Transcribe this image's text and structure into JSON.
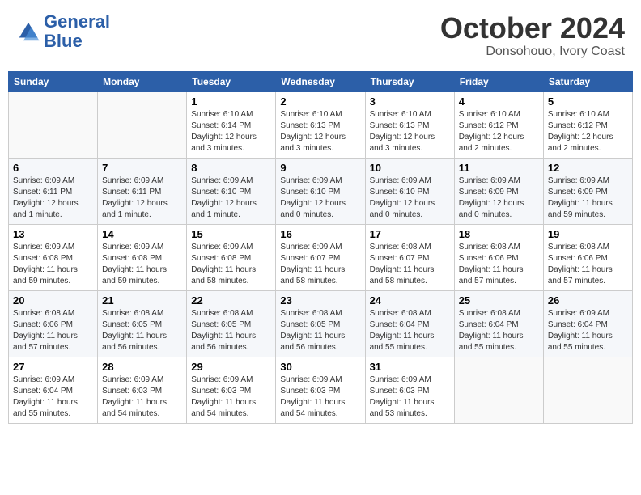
{
  "header": {
    "logo_line1": "General",
    "logo_line2": "Blue",
    "month": "October 2024",
    "location": "Donsohouo, Ivory Coast"
  },
  "days_of_week": [
    "Sunday",
    "Monday",
    "Tuesday",
    "Wednesday",
    "Thursday",
    "Friday",
    "Saturday"
  ],
  "weeks": [
    [
      {
        "day": "",
        "info": ""
      },
      {
        "day": "",
        "info": ""
      },
      {
        "day": "1",
        "info": "Sunrise: 6:10 AM\nSunset: 6:14 PM\nDaylight: 12 hours and 3 minutes."
      },
      {
        "day": "2",
        "info": "Sunrise: 6:10 AM\nSunset: 6:13 PM\nDaylight: 12 hours and 3 minutes."
      },
      {
        "day": "3",
        "info": "Sunrise: 6:10 AM\nSunset: 6:13 PM\nDaylight: 12 hours and 3 minutes."
      },
      {
        "day": "4",
        "info": "Sunrise: 6:10 AM\nSunset: 6:12 PM\nDaylight: 12 hours and 2 minutes."
      },
      {
        "day": "5",
        "info": "Sunrise: 6:10 AM\nSunset: 6:12 PM\nDaylight: 12 hours and 2 minutes."
      }
    ],
    [
      {
        "day": "6",
        "info": "Sunrise: 6:09 AM\nSunset: 6:11 PM\nDaylight: 12 hours and 1 minute."
      },
      {
        "day": "7",
        "info": "Sunrise: 6:09 AM\nSunset: 6:11 PM\nDaylight: 12 hours and 1 minute."
      },
      {
        "day": "8",
        "info": "Sunrise: 6:09 AM\nSunset: 6:10 PM\nDaylight: 12 hours and 1 minute."
      },
      {
        "day": "9",
        "info": "Sunrise: 6:09 AM\nSunset: 6:10 PM\nDaylight: 12 hours and 0 minutes."
      },
      {
        "day": "10",
        "info": "Sunrise: 6:09 AM\nSunset: 6:10 PM\nDaylight: 12 hours and 0 minutes."
      },
      {
        "day": "11",
        "info": "Sunrise: 6:09 AM\nSunset: 6:09 PM\nDaylight: 12 hours and 0 minutes."
      },
      {
        "day": "12",
        "info": "Sunrise: 6:09 AM\nSunset: 6:09 PM\nDaylight: 11 hours and 59 minutes."
      }
    ],
    [
      {
        "day": "13",
        "info": "Sunrise: 6:09 AM\nSunset: 6:08 PM\nDaylight: 11 hours and 59 minutes."
      },
      {
        "day": "14",
        "info": "Sunrise: 6:09 AM\nSunset: 6:08 PM\nDaylight: 11 hours and 59 minutes."
      },
      {
        "day": "15",
        "info": "Sunrise: 6:09 AM\nSunset: 6:08 PM\nDaylight: 11 hours and 58 minutes."
      },
      {
        "day": "16",
        "info": "Sunrise: 6:09 AM\nSunset: 6:07 PM\nDaylight: 11 hours and 58 minutes."
      },
      {
        "day": "17",
        "info": "Sunrise: 6:08 AM\nSunset: 6:07 PM\nDaylight: 11 hours and 58 minutes."
      },
      {
        "day": "18",
        "info": "Sunrise: 6:08 AM\nSunset: 6:06 PM\nDaylight: 11 hours and 57 minutes."
      },
      {
        "day": "19",
        "info": "Sunrise: 6:08 AM\nSunset: 6:06 PM\nDaylight: 11 hours and 57 minutes."
      }
    ],
    [
      {
        "day": "20",
        "info": "Sunrise: 6:08 AM\nSunset: 6:06 PM\nDaylight: 11 hours and 57 minutes."
      },
      {
        "day": "21",
        "info": "Sunrise: 6:08 AM\nSunset: 6:05 PM\nDaylight: 11 hours and 56 minutes."
      },
      {
        "day": "22",
        "info": "Sunrise: 6:08 AM\nSunset: 6:05 PM\nDaylight: 11 hours and 56 minutes."
      },
      {
        "day": "23",
        "info": "Sunrise: 6:08 AM\nSunset: 6:05 PM\nDaylight: 11 hours and 56 minutes."
      },
      {
        "day": "24",
        "info": "Sunrise: 6:08 AM\nSunset: 6:04 PM\nDaylight: 11 hours and 55 minutes."
      },
      {
        "day": "25",
        "info": "Sunrise: 6:08 AM\nSunset: 6:04 PM\nDaylight: 11 hours and 55 minutes."
      },
      {
        "day": "26",
        "info": "Sunrise: 6:09 AM\nSunset: 6:04 PM\nDaylight: 11 hours and 55 minutes."
      }
    ],
    [
      {
        "day": "27",
        "info": "Sunrise: 6:09 AM\nSunset: 6:04 PM\nDaylight: 11 hours and 55 minutes."
      },
      {
        "day": "28",
        "info": "Sunrise: 6:09 AM\nSunset: 6:03 PM\nDaylight: 11 hours and 54 minutes."
      },
      {
        "day": "29",
        "info": "Sunrise: 6:09 AM\nSunset: 6:03 PM\nDaylight: 11 hours and 54 minutes."
      },
      {
        "day": "30",
        "info": "Sunrise: 6:09 AM\nSunset: 6:03 PM\nDaylight: 11 hours and 54 minutes."
      },
      {
        "day": "31",
        "info": "Sunrise: 6:09 AM\nSunset: 6:03 PM\nDaylight: 11 hours and 53 minutes."
      },
      {
        "day": "",
        "info": ""
      },
      {
        "day": "",
        "info": ""
      }
    ]
  ]
}
